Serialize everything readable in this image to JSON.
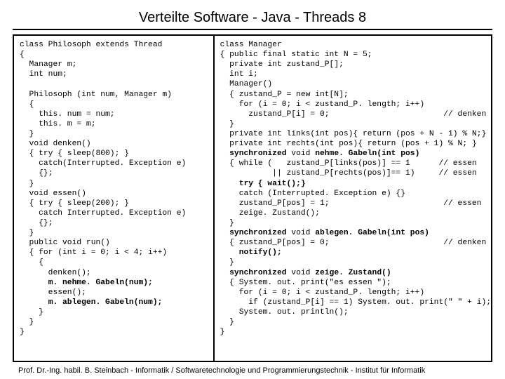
{
  "title": "Verteilte Software - Java - Threads 8",
  "footer": "Prof. Dr.-Ing. habil. B. Steinbach - Informatik / Softwaretechnologie und Programmierungstechnik - Institut für Informatik",
  "left_code_html": "class Philosoph extends Thread\n{\n  Manager m;\n  int num;\n\n  Philosoph (int num, Manager m)\n  {\n    this. num = num;\n    this. m = m;\n  }\n  void denken()\n  { try { sleep(800); }\n    catch(Interrupted. Exception e)\n    {};\n  }\n  void essen()\n  { try { sleep(200); }\n    catch Interrupted. Exception e)\n    {};\n  }\n  public void run()\n  { for (int i = 0; i &lt; 4; i++)\n    {\n      denken();\n      <b>m. nehme. Gabeln(num);</b>\n      essen();\n      <b>m. ablegen. Gabeln(num);</b>\n    }\n  }\n}",
  "right_code_html": "class Manager\n{ public final static int N = 5;\n  private int zustand_P[];\n  int i;\n  Manager()\n  { zustand_P = new int[N];\n    for (i = 0; i &lt; zustand_P. length; i++)\n      zustand_P[i] = 0;                        // denken\n  }\n  private int links(int pos){ return (pos + N - 1) % N;}\n  private int rechts(int pos){ return (pos + 1) % N; }\n  <b>synchronized</b> void <b>nehme. Gabeln(int pos)</b>\n  { while (   zustand_P[links(pos)] == 1      // essen\n           || zustand_P[rechts(pos)]== 1)     // essen\n    <b>try { wait();}</b>\n    catch (Interrupted. Exception e) {}\n    zustand_P[pos] = 1;                        // essen\n    zeige. Zustand();\n  }\n  <b>synchronized</b> void <b>ablegen. Gabeln(int pos)</b>\n  { zustand_P[pos] = 0;                        // denken\n    <b>notify();</b>\n  }\n  <b>synchronized</b> void <b>zeige. Zustand()</b>\n  { System. out. print(\"es essen \");\n    for (i = 0; i &lt; zustand_P. length; i++)\n      if (zustand_P[i] == 1) System. out. print(\" \" + i);\n    System. out. println();\n  }\n}"
}
